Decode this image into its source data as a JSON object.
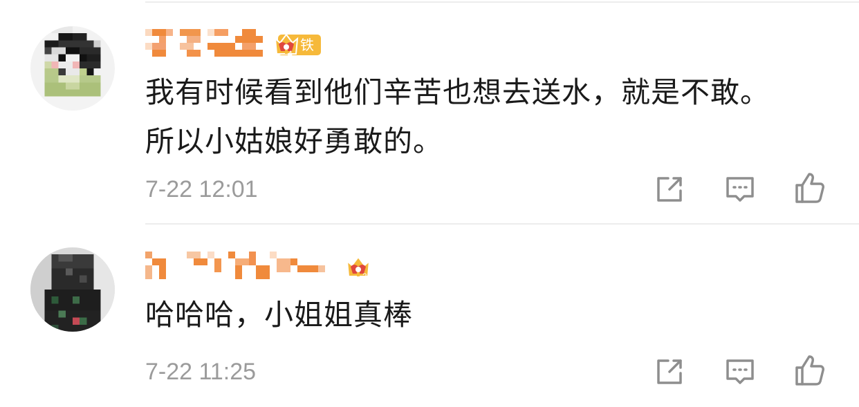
{
  "comments": [
    {
      "text_lines": [
        "我有时候看到他们辛苦也想去送水，就是不敢。",
        "所以小姑娘好勇敢的。"
      ],
      "time": "7-22 12:01",
      "badge_level": "4",
      "fan_label": "铁粉"
    },
    {
      "text_lines": [
        "哈哈哈，小姐姐真棒"
      ],
      "time": "7-22 11:25",
      "badge_level": "3"
    }
  ],
  "colors": {
    "text": "#1a1a1a",
    "muted": "#9b9b9b",
    "icon": "#8e8e8e",
    "divider": "#ececec",
    "username_mosaic": "#f08a3c",
    "badge_gold": "#f6b93a",
    "badge_red": "#e0483d"
  },
  "icons": {
    "repost": "share-square-arrow-icon",
    "comment": "comment-bubble-dots-icon",
    "like": "thumbs-up-icon",
    "badge": "crown-badge-icon"
  }
}
